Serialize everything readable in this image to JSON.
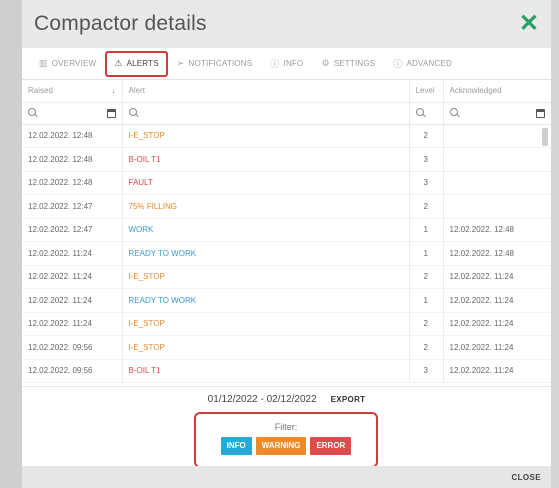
{
  "dialog": {
    "title": "Compactor details",
    "close_symbol": "✕"
  },
  "tabs": [
    {
      "label": "OVERVIEW",
      "icon": "chart-icon"
    },
    {
      "label": "ALERTS",
      "icon": "warning-icon",
      "active": true
    },
    {
      "label": "NOTIFICATIONS",
      "icon": "send-icon"
    },
    {
      "label": "INFO",
      "icon": "info-icon"
    },
    {
      "label": "SETTINGS",
      "icon": "gear-icon"
    },
    {
      "label": "ADVANCED",
      "icon": "info-icon"
    }
  ],
  "table": {
    "columns": [
      "Raised",
      "Alert",
      "Level",
      "Acknowledged"
    ],
    "rows": [
      {
        "raised": "12.02.2022. 12:48",
        "alert": "I-E_STOP",
        "severity": "warning",
        "level": "2",
        "acknowledged": ""
      },
      {
        "raised": "12.02.2022. 12:48",
        "alert": "B-OIL T1",
        "severity": "error",
        "level": "3",
        "acknowledged": ""
      },
      {
        "raised": "12.02.2022. 12:48",
        "alert": "FAULT",
        "severity": "error",
        "level": "3",
        "acknowledged": ""
      },
      {
        "raised": "12.02.2022. 12:47",
        "alert": "75% FILLING",
        "severity": "warning",
        "level": "2",
        "acknowledged": ""
      },
      {
        "raised": "12.02.2022. 12:47",
        "alert": "WORK",
        "severity": "info",
        "level": "1",
        "acknowledged": "12.02.2022. 12:48"
      },
      {
        "raised": "12.02.2022. 11:24",
        "alert": "READY TO WORK",
        "severity": "info",
        "level": "1",
        "acknowledged": "12.02.2022. 12:48"
      },
      {
        "raised": "12.02.2022. 11:24",
        "alert": "I-E_STOP",
        "severity": "warning",
        "level": "2",
        "acknowledged": "12.02.2022. 11:24"
      },
      {
        "raised": "12.02.2022. 11:24",
        "alert": "READY TO WORK",
        "severity": "info",
        "level": "1",
        "acknowledged": "12.02.2022. 11:24"
      },
      {
        "raised": "12.02.2022. 11:24",
        "alert": "I-E_STOP",
        "severity": "warning",
        "level": "2",
        "acknowledged": "12.02.2022. 11:24"
      },
      {
        "raised": "12.02.2022. 09:56",
        "alert": "I-E_STOP",
        "severity": "warning",
        "level": "2",
        "acknowledged": "12.02.2022. 11:24"
      },
      {
        "raised": "12.02.2022. 09:56",
        "alert": "B-OIL T1",
        "severity": "error",
        "level": "3",
        "acknowledged": "12.02.2022. 11:24"
      }
    ]
  },
  "footer": {
    "date_range": "01/12/2022 - 02/12/2022",
    "export_label": "EXPORT"
  },
  "filter": {
    "label": "Filter:",
    "buttons": [
      "INFO",
      "WARNING",
      "ERROR"
    ]
  },
  "bottom": {
    "close_label": "CLOSE"
  },
  "colors": {
    "accent_green": "#2a9e62",
    "highlight_red": "#d23b3b",
    "info": "#29a7db",
    "warning": "#ef8a2a",
    "error": "#df4c4e"
  }
}
